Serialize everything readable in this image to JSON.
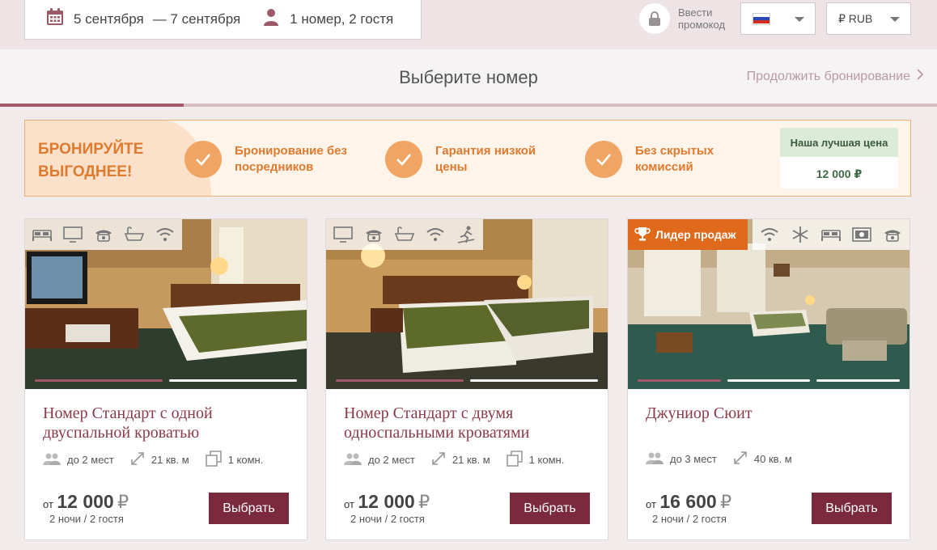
{
  "search": {
    "date_from": "5 сентября",
    "date_to": "— 7 сентября",
    "guests": "1 номер, 2 гостя"
  },
  "promo": {
    "label": "Ввести промокод"
  },
  "language": {
    "selected": "RU",
    "flag": "russia-flag-icon"
  },
  "currency": {
    "selected": "₽ RUB"
  },
  "step": {
    "title": "Выберите номер",
    "continue_label": "Продолжить бронирование",
    "progress": 0.196
  },
  "benefits": {
    "headline": "БРОНИРУЙТЕ ВЫГОДНЕЕ!",
    "items": [
      {
        "text": "Бронирование без посредников"
      },
      {
        "text": "Гарантия низкой цены"
      },
      {
        "text": "Без скрытых комиссий"
      }
    ],
    "best_price_label": "Наша лучшая цена",
    "best_price_value": "12 000 ₽"
  },
  "rooms": [
    {
      "title": "Номер Стандарт с одной двуспальной кроватью",
      "amenities": [
        "bed-icon",
        "tv-icon",
        "phone-icon",
        "bath-icon",
        "wifi-icon"
      ],
      "capacity": "до 2 мест",
      "area": "21 кв. м",
      "rooms": "1 комн.",
      "price_prefix": "от",
      "price": "12 000",
      "currency_symbol": "₽",
      "price_note": "2 ночи / 2 гостя",
      "button": "Выбрать",
      "photo_count": 2,
      "photo_active": 1
    },
    {
      "title": "Номер Стандарт с двумя односпальными кроватями",
      "amenities": [
        "tv-icon",
        "phone-icon",
        "bath-icon",
        "wifi-icon",
        "gym-icon"
      ],
      "capacity": "до 2 мест",
      "area": "21 кв. м",
      "rooms": "1 комн.",
      "price_prefix": "от",
      "price": "12 000",
      "currency_symbol": "₽",
      "price_note": "2 ночи / 2 гостя",
      "button": "Выбрать",
      "photo_count": 2,
      "photo_active": 1
    },
    {
      "title": "Джуниор Сюит",
      "badge": "Лидер продаж",
      "amenities": [
        "wifi-icon",
        "snowflake-icon",
        "bed-icon",
        "safe-icon",
        "phone-icon"
      ],
      "capacity": "до 3 мест",
      "area": "40 кв. м",
      "price_prefix": "от",
      "price": "16 600",
      "currency_symbol": "₽",
      "price_note": "2 ночи / 2 гостя",
      "button": "Выбрать",
      "photo_count": 3,
      "photo_active": 1
    }
  ],
  "colors": {
    "accent": "#7a2a3c",
    "benefit_orange": "#e07a2e",
    "badge_orange": "#e06a1c",
    "title_wine": "#8a3a4a"
  }
}
